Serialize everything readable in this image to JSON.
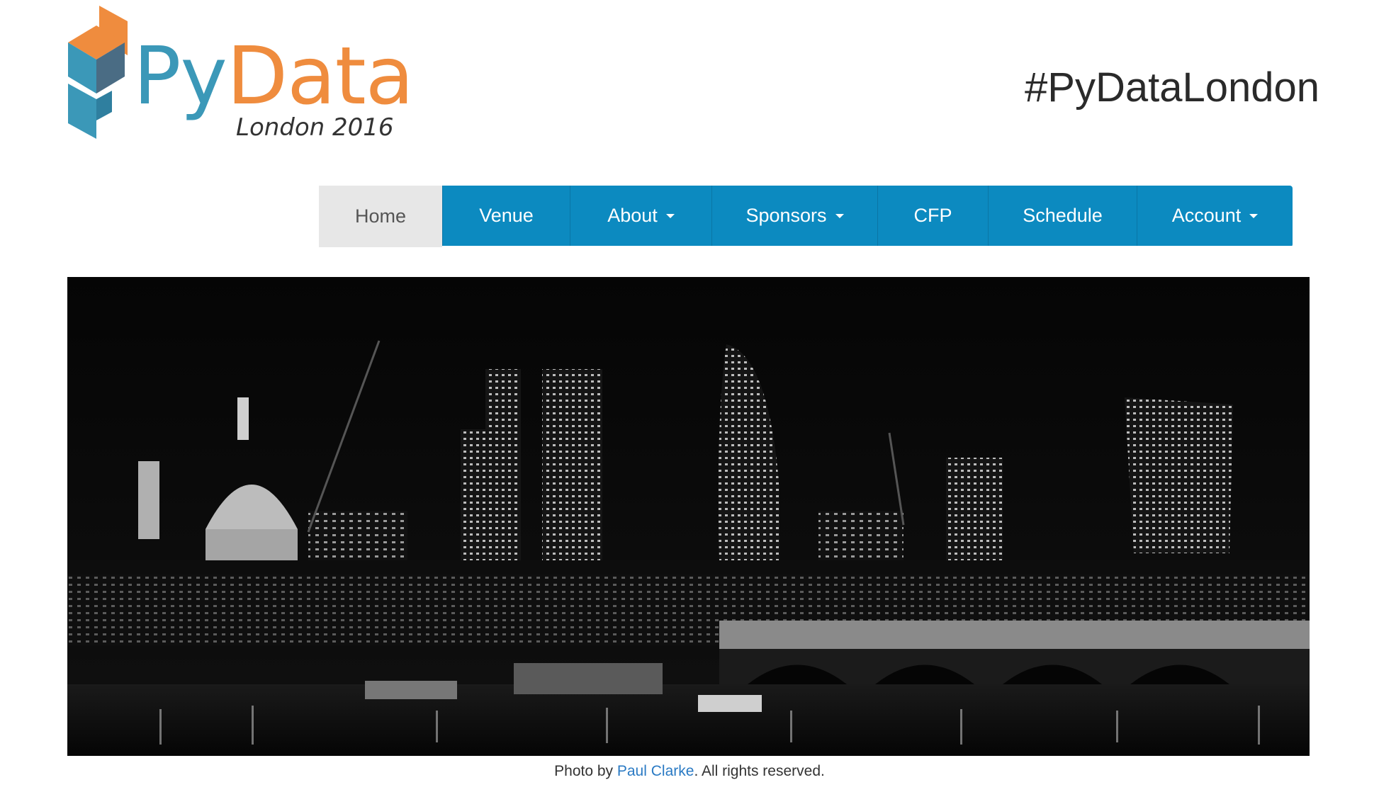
{
  "logo": {
    "brand_part1": "Py",
    "brand_part2": "Data",
    "subtitle": "London 2016"
  },
  "header": {
    "hashtag": "#PyDataLondon"
  },
  "nav": {
    "items": [
      {
        "label": "Home",
        "active": true,
        "dropdown": false
      },
      {
        "label": "Venue",
        "dropdown": false
      },
      {
        "label": "About",
        "dropdown": true
      },
      {
        "label": "Sponsors",
        "dropdown": true
      },
      {
        "label": "CFP",
        "dropdown": false
      },
      {
        "label": "Schedule",
        "dropdown": false
      },
      {
        "label": "Account",
        "dropdown": true
      }
    ]
  },
  "hero": {
    "icon": "london-skyline-night-photo"
  },
  "caption": {
    "prefix": "Photo by ",
    "author": "Paul Clarke",
    "suffix": ". All rights reserved."
  },
  "colors": {
    "nav_bg": "#0c8ac0",
    "nav_active_bg": "#e7e7e7",
    "logo_blue": "#3b98b8",
    "logo_orange": "#ef8c3e",
    "link": "#2a7ac4"
  }
}
